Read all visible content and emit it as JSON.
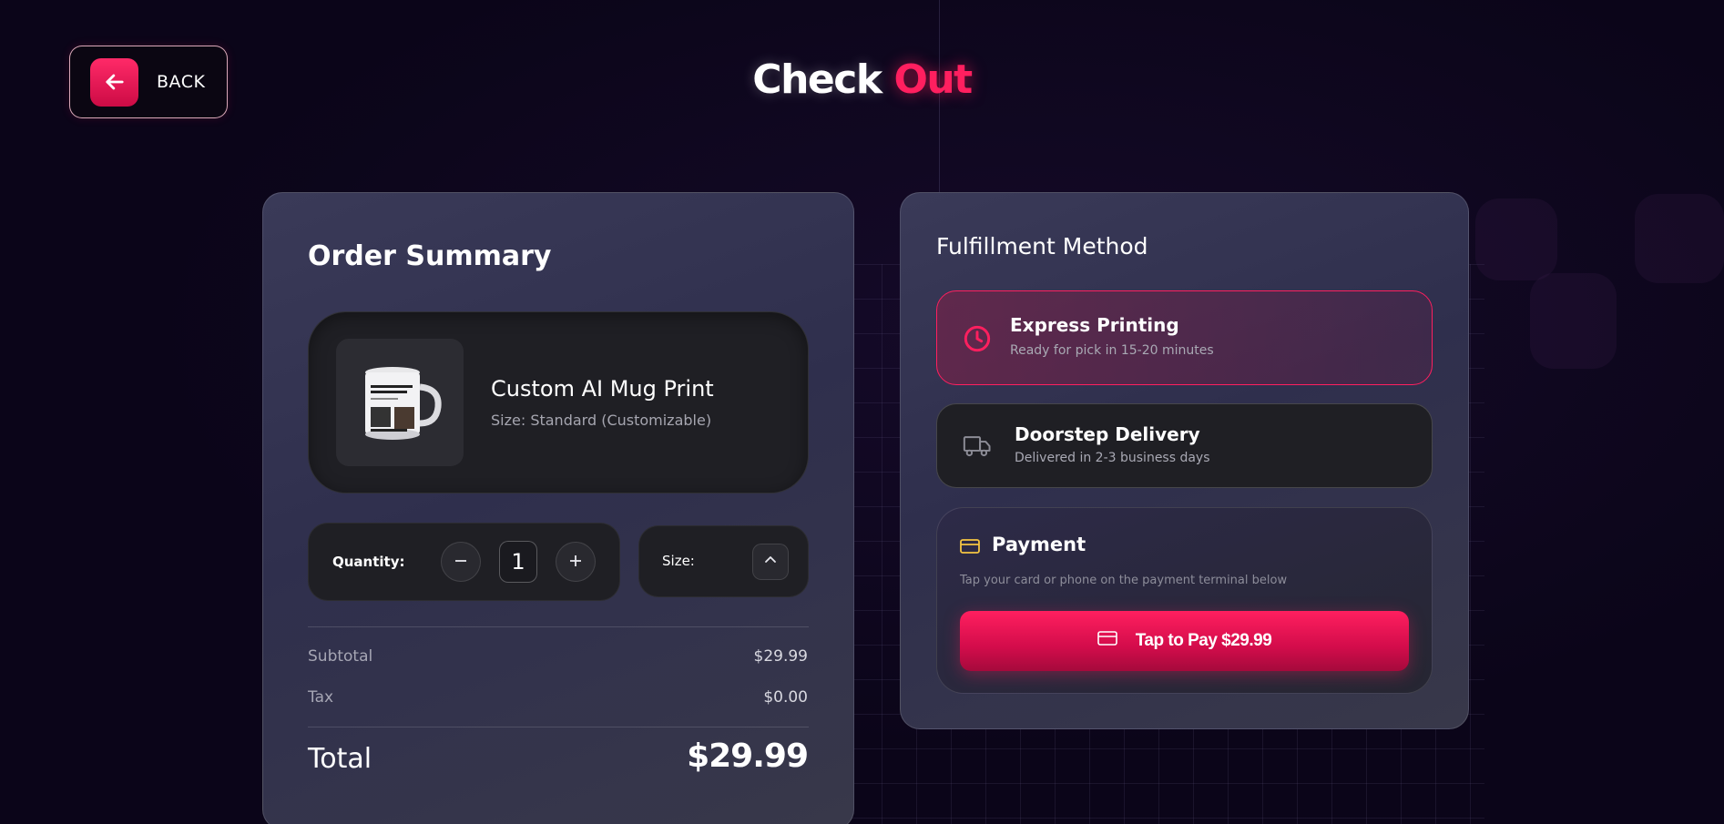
{
  "header": {
    "back_label": "BACK",
    "title_part1": "Check",
    "title_part2": "Out"
  },
  "order_summary": {
    "title": "Order Summary",
    "product": {
      "name": "Custom AI Mug Print",
      "size_text": "Size: Standard (Customizable)",
      "image": "mug-icon"
    },
    "quantity": {
      "label": "Quantity:",
      "value": "1"
    },
    "size": {
      "label": "Size:"
    },
    "subtotal_label": "Subtotal",
    "subtotal_value": "$29.99",
    "tax_label": "Tax",
    "tax_value": "$0.00",
    "total_label": "Total",
    "total_value": "$29.99"
  },
  "fulfillment": {
    "title": "Fulfillment Method",
    "options": [
      {
        "title": "Express Printing",
        "subtitle": "Ready for pick in 15-20 minutes",
        "icon": "clock-icon",
        "selected": true
      },
      {
        "title": "Doorstep Delivery",
        "subtitle": "Delivered in 2-3 business days",
        "icon": "truck-icon",
        "selected": false
      }
    ],
    "payment": {
      "title": "Payment",
      "subtitle": "Tap your card or phone on the payment terminal below",
      "button_label": "Tap to Pay $29.99",
      "icon": "credit-card-icon"
    }
  },
  "colors": {
    "accent": "#ff1f5f",
    "background": "#0b0519",
    "card": "#34344f",
    "payment_icon": "#f5c542"
  }
}
